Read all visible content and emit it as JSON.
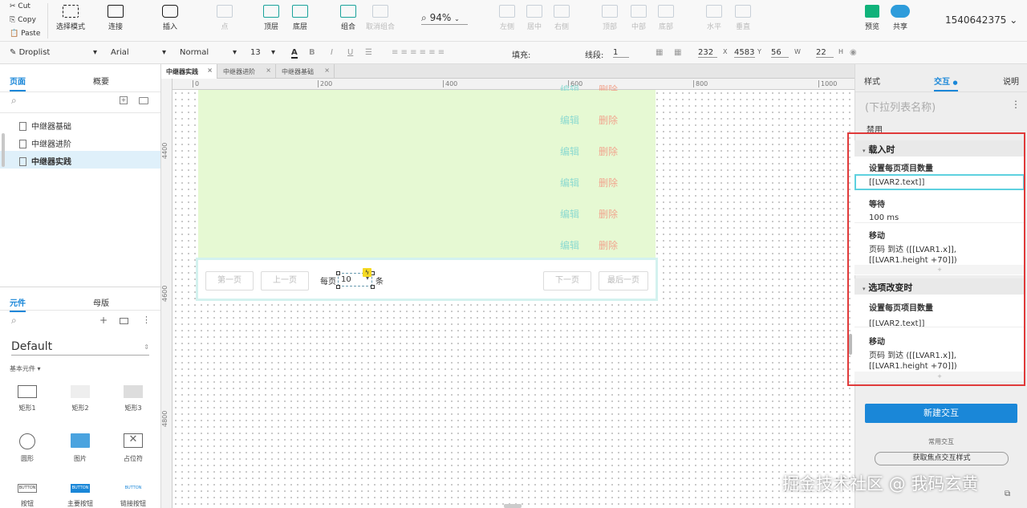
{
  "toolbar": {
    "cut": "Cut",
    "copy": "Copy",
    "paste": "Paste",
    "select_mode": "选择模式",
    "connect": "连接",
    "insert": "插入",
    "point": "点",
    "top_layer": "顶层",
    "bottom_layer": "底层",
    "group": "组合",
    "ungroup": "取消组合",
    "zoom": "94%",
    "align_left": "左侧",
    "align_center": "居中",
    "align_right": "右侧",
    "align_top": "顶部",
    "align_middle": "中部",
    "align_bottom": "底部",
    "distribute_h": "水平",
    "distribute_v": "垂直",
    "preview": "预览",
    "share": "共享",
    "account": "1540642375"
  },
  "format": {
    "widget_type": "Droplist",
    "font": "Arial",
    "style": "Normal",
    "size": "13",
    "fill_label": "填充:",
    "line_label": "线段:",
    "line_value": "1",
    "x": "232",
    "x_label": "X",
    "y": "4583",
    "y_label": "Y",
    "w": "56",
    "w_label": "W",
    "h": "22",
    "h_label": "H"
  },
  "pages": {
    "tab_pages": "页面",
    "tab_outline": "概要",
    "items": [
      "中继器基础",
      "中继器进阶",
      "中继器实践"
    ]
  },
  "library": {
    "tab_widgets": "元件",
    "tab_masters": "母版",
    "library_name": "Default",
    "category": "基本元件 ▾",
    "widgets": [
      "矩形1",
      "矩形2",
      "矩形3",
      "圆形",
      "图片",
      "占位符",
      "按钮",
      "主要按钮",
      "链接按钮"
    ],
    "button_text": "BUTTON"
  },
  "doc_tabs": [
    "中继器实践",
    "中继器进阶",
    "中继器基础"
  ],
  "rulers": {
    "h": [
      "0",
      "200",
      "400",
      "600",
      "800",
      "1000"
    ],
    "v": [
      "4400",
      "4600",
      "4800"
    ]
  },
  "table_rows": [
    {
      "edit": "编辑",
      "delete": "删除"
    },
    {
      "edit": "编辑",
      "delete": "删除"
    },
    {
      "edit": "编辑",
      "delete": "删除"
    },
    {
      "edit": "编辑",
      "delete": "删除"
    },
    {
      "edit": "编辑",
      "delete": "删除"
    },
    {
      "edit": "编辑",
      "delete": "删除"
    }
  ],
  "pager": {
    "first": "第一页",
    "prev": "上一页",
    "per_page": "每页",
    "count": "10",
    "unit": "条",
    "next": "下一页",
    "last": "最后一页"
  },
  "inspector": {
    "tab_style": "样式",
    "tab_interaction": "交互",
    "tab_notes": "说明",
    "widget_name_placeholder": "(下拉列表名称)",
    "disabled": "禁用",
    "on_load": {
      "title": "载入时",
      "a1_title": "设置每页项目数量",
      "a1_value": "[[LVAR2.text]]",
      "a2_title": "等待",
      "a2_value": "100 ms",
      "a3_title": "移动",
      "a3_value": "页码 到达 ([[LVAR1.x]],[[LVAR1.height +70]])"
    },
    "on_change": {
      "title": "选项改变时",
      "a1_title": "设置每页项目数量",
      "a1_value": "[[LVAR2.text]]",
      "a2_title": "移动",
      "a2_value": "页码 到达 ([[LVAR1.x]],[[LVAR1.height +70]])"
    },
    "new_interaction": "新建交互",
    "common_interactions": "常用交互",
    "focus_style": "获取焦点交互样式"
  },
  "watermark": "掘金技术社区 @ 我码玄黄",
  "colors": {
    "accent": "#1a87d8",
    "highlight": "#e03a3a",
    "canvas_green": "#e6f9d3"
  }
}
